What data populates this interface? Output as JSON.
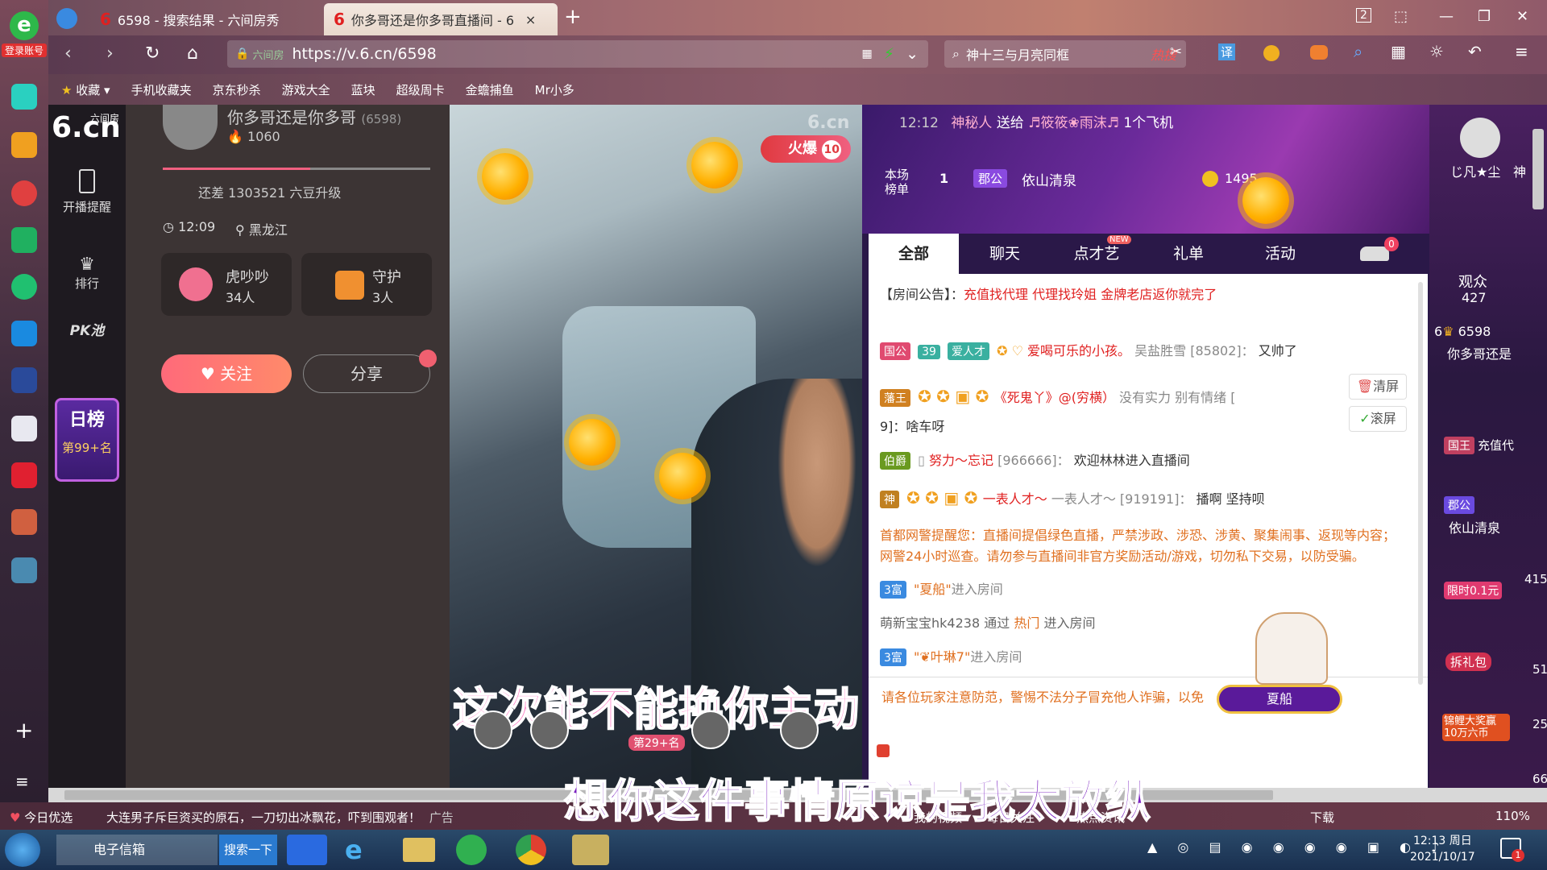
{
  "browser": {
    "tabs": [
      {
        "label": "6598 - 搜索结果 - 六间房秀"
      },
      {
        "label": "你多哥还是你多哥直播间 - 6"
      }
    ],
    "new_tab": "+",
    "login_label": "登录账号",
    "url": "https://v.6.cn/6598",
    "url_prefix": "六间房",
    "search_text": "神十三与月亮同框",
    "search_hot": "热搜",
    "tab_count": "2",
    "translate": "译"
  },
  "bookmarks": [
    "收藏",
    "手机收藏夹",
    "京东秒杀",
    "游戏大全",
    "蓝块",
    "超级周卡",
    "金蟾捕鱼",
    "Mr小多"
  ],
  "site_nav": {
    "logo_text": "6.cn",
    "logo_sub": "六间房",
    "items": [
      {
        "label": "开播提醒"
      },
      {
        "label": "排行"
      },
      {
        "label": "PK池"
      }
    ],
    "rank_title": "日榜",
    "rank_value": "第99+名"
  },
  "room": {
    "host_name": "你多哥还是你多哥",
    "room_id": "(6598)",
    "fans": "1060",
    "upgrade_text": "还差 1303521 六豆升级",
    "time": "12:09",
    "location": "黑龙江",
    "fan_club": {
      "name": "虎吵吵",
      "count": "34人"
    },
    "guard": {
      "name": "守护",
      "count": "3人"
    },
    "follow_label": "关注",
    "share_label": "分享"
  },
  "video": {
    "hot_label": "火爆",
    "hot_level": "10",
    "watermark": "6.cn",
    "subtitle1": "这次能不能换你主动",
    "subtitle2": "想你这件事情原谅是我太放纵",
    "rank_chip": "第29+名"
  },
  "chat": {
    "gift_broadcast": {
      "time": "12:12",
      "sender": "神秘人",
      "action": "送给",
      "receiver": "♬筱筱❀雨沫♬",
      "gift": "1个飞机"
    },
    "board_label": "本场榜单",
    "board_rank": "1",
    "board_badge": "郡公",
    "board_user": "依山清泉",
    "board_coins": "1495",
    "tabs": [
      {
        "label": "全部"
      },
      {
        "label": "聊天"
      },
      {
        "label": "点才艺"
      },
      {
        "label": "礼单"
      },
      {
        "label": "活动"
      }
    ],
    "new_badge": "NEW",
    "car_count": "0",
    "notice_label": "【房间公告】：",
    "notice_text": "充值找代理 代理找玲姐 金牌老店返你就完了",
    "messages": [
      {
        "badge": "国公",
        "level": "39",
        "tag": "爱人才",
        "user": "爱喝可乐的小孩。",
        "to": "吴盐胜雪 [85802]：",
        "text": "又帅了"
      },
      {
        "badge": "藩王",
        "user": "《死鬼丫》@(穷横）",
        "to": "没有实力 别有情绪 [",
        "text": "9]：啥车呀"
      },
      {
        "badge": "伯爵",
        "user": "努力～忘记",
        "to": "[966666]：",
        "text": "欢迎林林进入直播间"
      },
      {
        "badge": "神",
        "user": "一表人才～",
        "to": "一表人才～ [919191]：",
        "text": "播啊 坚持呗"
      }
    ],
    "police_text": "首都网警提醒您：直播间提倡绿色直播，严禁涉政、涉恐、涉黄、聚集闹事、返现等内容；网警24小时巡查。请勿参与直播间非官方奖励活动/游戏，切勿私下交易，以防受骗。",
    "enter1": {
      "badge": "3富",
      "user": "\"夏船\"",
      "text": "进入房间"
    },
    "enter2": {
      "user": "萌新宝宝hk4238",
      "via": "通过",
      "source": "热门",
      "text": "进入房间"
    },
    "enter3": {
      "badge": "3富",
      "user": "\"❦叶琳7\"",
      "text": "进入房间"
    },
    "clear_label": "清屏",
    "scroll_label": "滚屏",
    "warning_text": "请各位玩家注意防范，警惕不法分子冒充他人诈骗，以免",
    "ride_name": "夏船"
  },
  "audience": {
    "top_user": "じ凡★尘",
    "top_user2": "神",
    "label": "观众",
    "count": "427",
    "list": [
      {
        "level": "6",
        "name": "6598",
        "sub": "你多哥还是"
      },
      {
        "badge": "国王",
        "name": "充值代"
      },
      {
        "badge": "郡公",
        "name": "依山清泉"
      }
    ],
    "promo1": "限时0.1元",
    "promo2": "拆礼包",
    "promo3": "锦鲤大奖赢10万六币",
    "num1": "415",
    "num2": "51",
    "num3": "25",
    "num4": "66"
  },
  "statusbar": {
    "left1": "今日优选",
    "news": "大连男子斥巨资买的原石，一刀切出冰飘花，吓到围观者！",
    "ad": "广告",
    "items": [
      "我的视频",
      "每日关注",
      "热点资讯"
    ],
    "download": "下载",
    "zoom": "110%"
  },
  "taskbar": {
    "app1": "电子信箱",
    "search_btn": "搜索一下",
    "time": "12:13 周日",
    "date": "2021/10/17",
    "notif": "1"
  }
}
